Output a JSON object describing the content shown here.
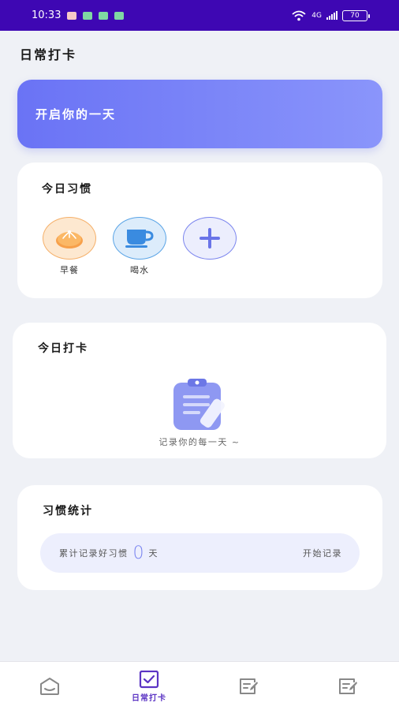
{
  "status_bar": {
    "time": "10:33",
    "network": "4G",
    "battery": "70",
    "background_color": "#3e07b3"
  },
  "header": {
    "title": "日常打卡"
  },
  "banner": {
    "text": "开启你的一天",
    "gradient_start": "#6a73f5",
    "gradient_end": "#8a95fb"
  },
  "habits": {
    "title": "今日习惯",
    "items": [
      {
        "label": "早餐",
        "icon": "bun-icon",
        "bg": "#fde8d0",
        "border": "#f5b06a"
      },
      {
        "label": "喝水",
        "icon": "cup-icon",
        "bg": "#dcecfb",
        "border": "#5aa4e6"
      },
      {
        "label": "",
        "icon": "plus-icon",
        "bg": "#eceefd",
        "border": "#7b85ee"
      }
    ]
  },
  "checkin": {
    "title": "今日打卡",
    "empty_text": "记录你的每一天 ~",
    "icon": "clipboard-icon"
  },
  "stats": {
    "title": "习惯统计",
    "prefix": "累计记录好习惯",
    "count": "0",
    "unit": "天",
    "start_label": "开始记录"
  },
  "tabbar": {
    "active_color": "#5b34c4",
    "tabs": [
      {
        "icon": "home-icon",
        "label": ""
      },
      {
        "icon": "checkbox-icon",
        "label": "日常打卡",
        "active": true
      },
      {
        "icon": "notes-icon",
        "label": ""
      },
      {
        "icon": "notes-icon",
        "label": ""
      }
    ]
  }
}
